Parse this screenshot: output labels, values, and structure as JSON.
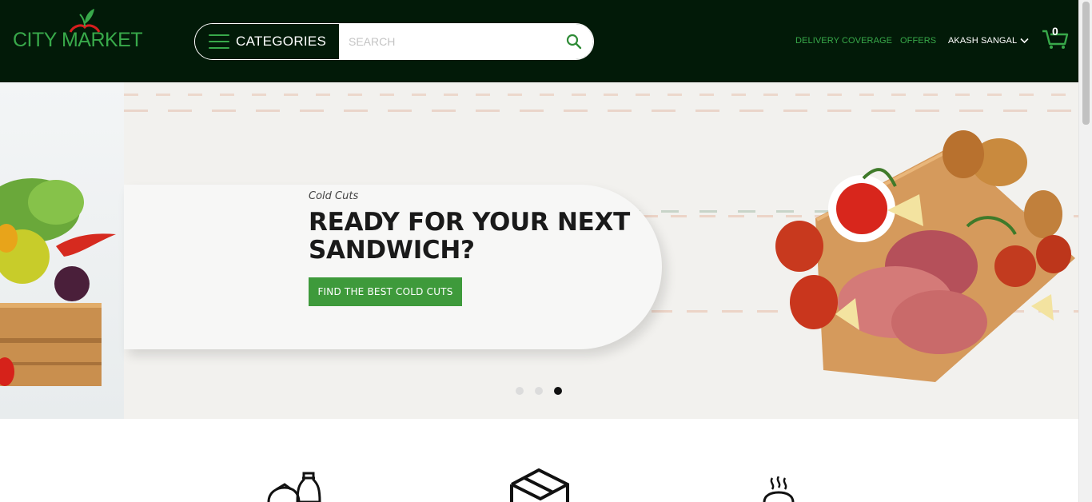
{
  "brand": {
    "name": "CITY MARKET",
    "color": "#38a94a",
    "apple_color": "#d71e1e"
  },
  "header": {
    "background": "#021a08",
    "categories_label": "CATEGORIES",
    "search_placeholder": "SEARCH",
    "search_value": "",
    "nav": {
      "delivery": "DELIVERY COVERAGE",
      "offers": "OFFERS",
      "user": "AKASH SANGAL"
    },
    "cart_count": "0"
  },
  "hero": {
    "subtitle": "Cold Cuts",
    "title": "READY FOR YOUR NEXT SANDWICH?",
    "cta": "FIND THE BEST COLD CUTS",
    "cta_color": "#3e9a3b",
    "slides": 3,
    "active_slide": 3
  },
  "features": {
    "icons": [
      "groceries-icon",
      "box-icon",
      "hot-food-icon"
    ]
  }
}
